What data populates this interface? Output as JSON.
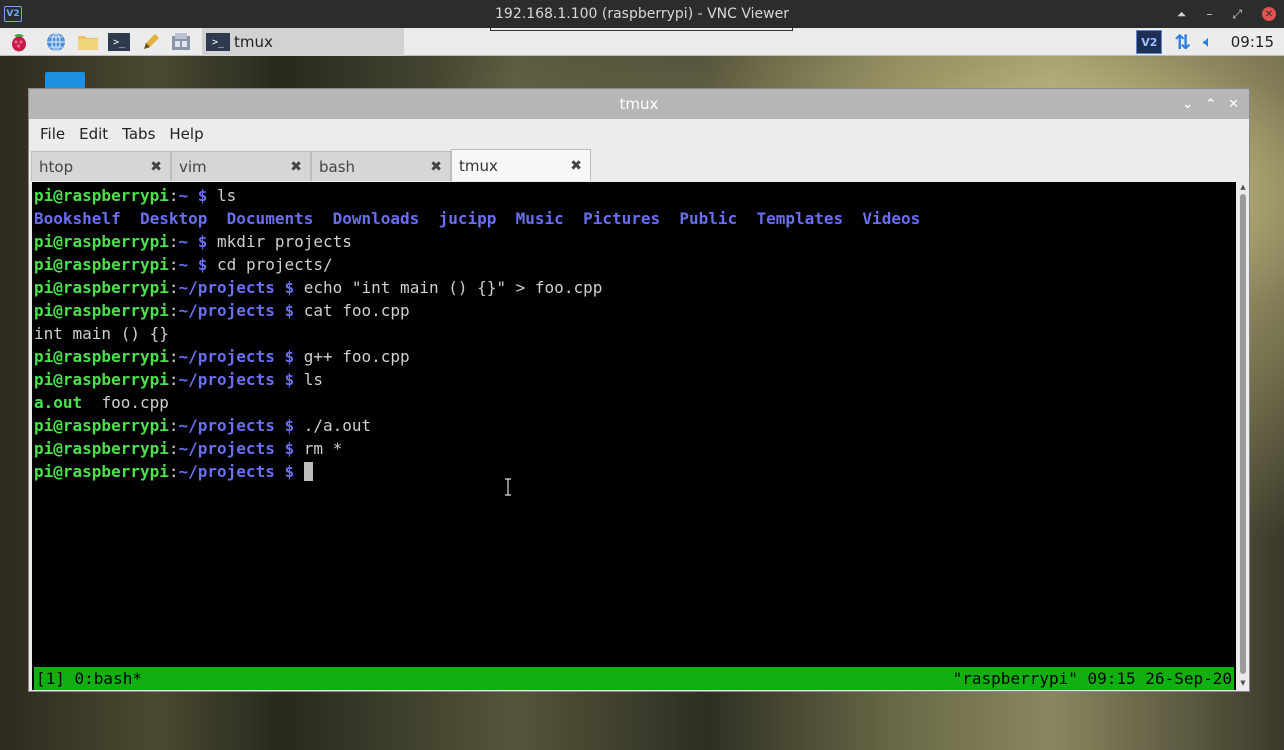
{
  "vnc": {
    "title": "192.168.1.100 (raspberrypi) - VNC Viewer",
    "logo": "V2",
    "controls": [
      "⏶",
      "–",
      "⤢",
      "✕"
    ]
  },
  "taskbar": {
    "icons": [
      "raspberry-icon",
      "browser-globe-icon",
      "file-manager-folder-icon",
      "terminal-icon",
      "text-editor-pencil-icon",
      "apps-icon"
    ],
    "task_label": "tmux",
    "tray_vnc": "V2",
    "clock": "09:15"
  },
  "window": {
    "title": "tmux",
    "menu": [
      "File",
      "Edit",
      "Tabs",
      "Help"
    ],
    "tabs": [
      {
        "label": "htop",
        "active": false
      },
      {
        "label": "vim",
        "active": false
      },
      {
        "label": "bash",
        "active": false
      },
      {
        "label": "tmux",
        "active": true
      }
    ]
  },
  "terminal": {
    "lines": [
      [
        {
          "t": "pi@raspberrypi",
          "c": "g"
        },
        {
          "t": ":",
          "c": "w"
        },
        {
          "t": "~ $",
          "c": "b"
        },
        {
          "t": " ls",
          "c": "w"
        }
      ],
      [
        {
          "t": "Bookshelf  Desktop  Documents  Downloads  jucipp  Music  Pictures  Public  Templates  Videos",
          "c": "b"
        }
      ],
      [
        {
          "t": "pi@raspberrypi",
          "c": "g"
        },
        {
          "t": ":",
          "c": "w"
        },
        {
          "t": "~ $",
          "c": "b"
        },
        {
          "t": " mkdir projects",
          "c": "w"
        }
      ],
      [
        {
          "t": "pi@raspberrypi",
          "c": "g"
        },
        {
          "t": ":",
          "c": "w"
        },
        {
          "t": "~ $",
          "c": "b"
        },
        {
          "t": " cd projects/",
          "c": "w"
        }
      ],
      [
        {
          "t": "pi@raspberrypi",
          "c": "g"
        },
        {
          "t": ":",
          "c": "w"
        },
        {
          "t": "~/projects $",
          "c": "b"
        },
        {
          "t": " echo \"int main () {}\" > foo.cpp",
          "c": "w"
        }
      ],
      [
        {
          "t": "pi@raspberrypi",
          "c": "g"
        },
        {
          "t": ":",
          "c": "w"
        },
        {
          "t": "~/projects $",
          "c": "b"
        },
        {
          "t": " cat foo.cpp",
          "c": "w"
        }
      ],
      [
        {
          "t": "int main () {}",
          "c": "w"
        }
      ],
      [
        {
          "t": "pi@raspberrypi",
          "c": "g"
        },
        {
          "t": ":",
          "c": "w"
        },
        {
          "t": "~/projects $",
          "c": "b"
        },
        {
          "t": " g++ foo.cpp",
          "c": "w"
        }
      ],
      [
        {
          "t": "pi@raspberrypi",
          "c": "g"
        },
        {
          "t": ":",
          "c": "w"
        },
        {
          "t": "~/projects $",
          "c": "b"
        },
        {
          "t": " ls",
          "c": "w"
        }
      ],
      [
        {
          "t": "a.out",
          "c": "g"
        },
        {
          "t": "  foo.cpp",
          "c": "w"
        }
      ],
      [
        {
          "t": "pi@raspberrypi",
          "c": "g"
        },
        {
          "t": ":",
          "c": "w"
        },
        {
          "t": "~/projects $",
          "c": "b"
        },
        {
          "t": " ./a.out",
          "c": "w"
        }
      ],
      [
        {
          "t": "pi@raspberrypi",
          "c": "g"
        },
        {
          "t": ":",
          "c": "w"
        },
        {
          "t": "~/projects $",
          "c": "b"
        },
        {
          "t": " rm *",
          "c": "w"
        }
      ],
      [
        {
          "t": "pi@raspberrypi",
          "c": "g"
        },
        {
          "t": ":",
          "c": "w"
        },
        {
          "t": "~/projects $",
          "c": "b"
        },
        {
          "t": " ",
          "c": "w"
        }
      ]
    ],
    "status_left": "[1] 0:bash*",
    "status_right": "\"raspberrypi\" 09:15 26-Sep-20"
  },
  "colors": {
    "prompt_user": "#4ce04c",
    "prompt_path": "#6a6ef0",
    "status_bar": "#0fb00f"
  }
}
